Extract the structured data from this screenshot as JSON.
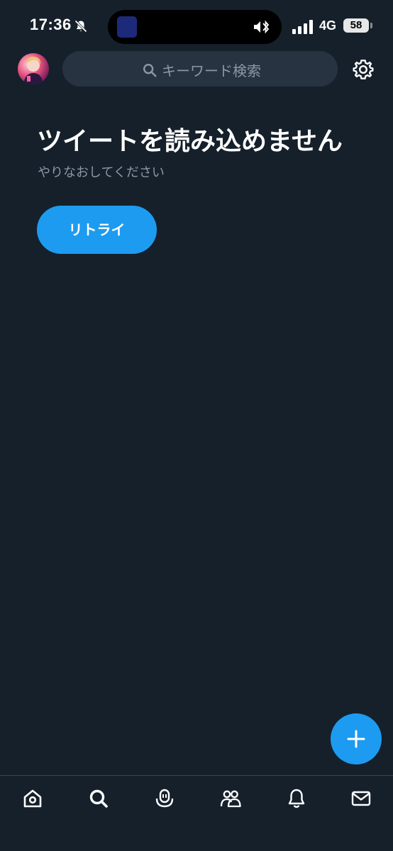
{
  "status_bar": {
    "time": "17:36",
    "network": "4G",
    "battery": "58",
    "icons": [
      "bell-off-icon",
      "media-thumbnail",
      "speaker-bluetooth-icon",
      "signal-icon",
      "battery-icon"
    ]
  },
  "header": {
    "search_placeholder": "キーワード検索",
    "icons": [
      "avatar",
      "search-icon",
      "settings-icon"
    ]
  },
  "main": {
    "error_title": "ツイートを読み込めません",
    "error_subtitle": "やりなおしてください",
    "retry_label": "リトライ"
  },
  "fab": {
    "icon": "plus-icon"
  },
  "bottom_nav": {
    "items": [
      "home-icon",
      "search-icon",
      "spaces-icon",
      "communities-icon",
      "notifications-icon",
      "messages-icon"
    ],
    "active": "search-icon"
  },
  "colors": {
    "background": "#15202b",
    "accent": "#1d9bf0",
    "search_bg": "#273340",
    "secondary_text": "#8b98a5",
    "divider": "#38444d"
  }
}
